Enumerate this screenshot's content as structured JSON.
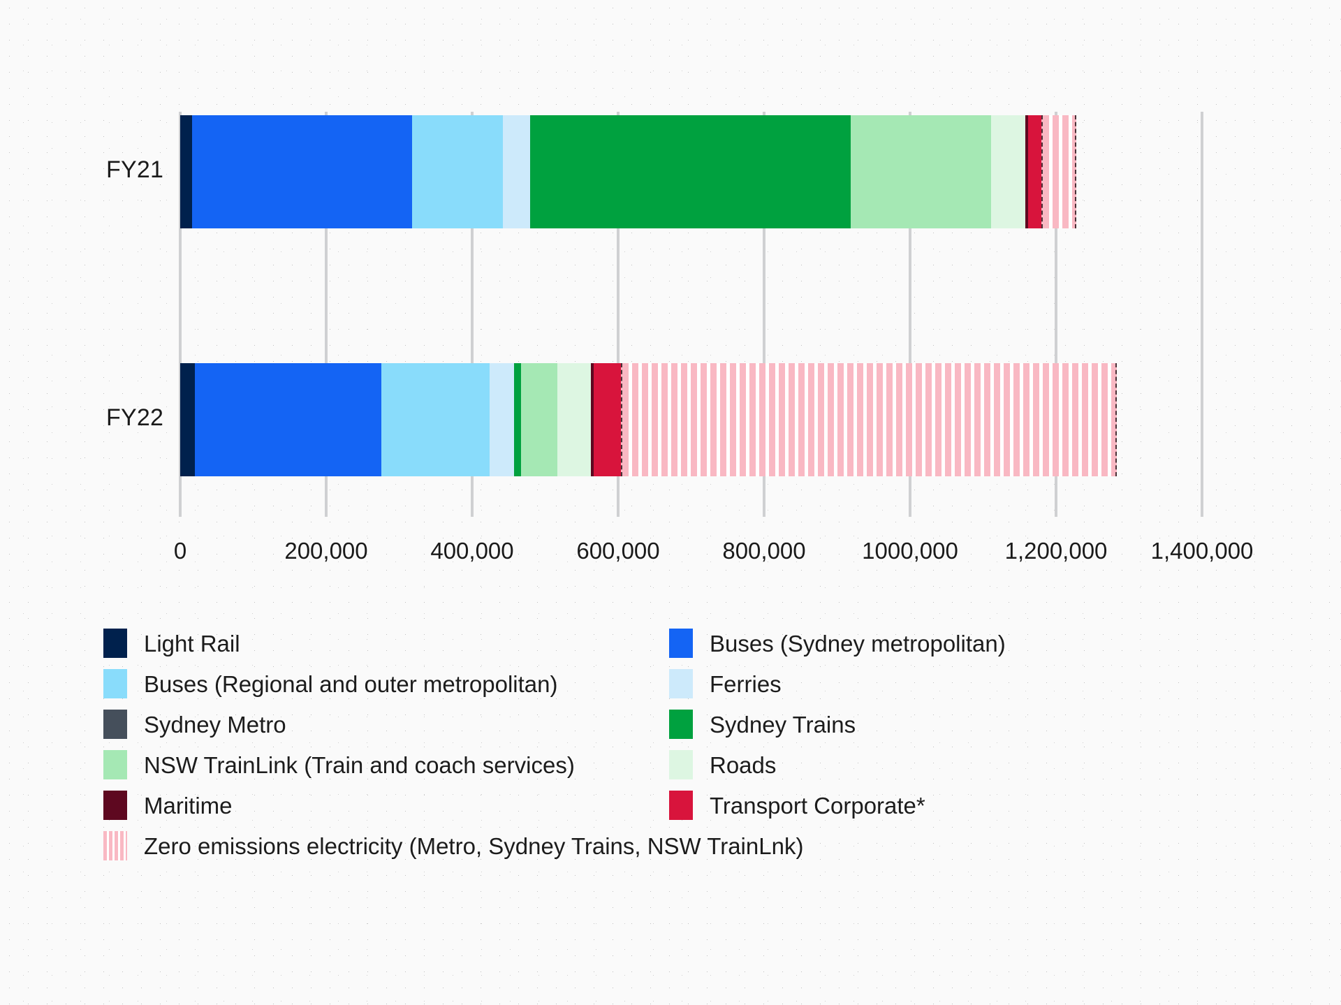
{
  "chart_data": {
    "type": "bar",
    "orientation": "horizontal",
    "stacked": true,
    "title": "",
    "xlabel": "",
    "ylabel": "",
    "categories": [
      "FY21",
      "FY22"
    ],
    "xlim": [
      0,
      1450000
    ],
    "xticks": [
      0,
      200000,
      400000,
      600000,
      800000,
      1000000,
      1200000,
      1400000
    ],
    "xticklabels": [
      "0",
      "200,000",
      "400,000",
      "600,000",
      "800,000",
      "1000,000",
      "1,200,000",
      "1,400,000"
    ],
    "grid": true,
    "grid_axis": "x",
    "legend_position": "bottom",
    "series": [
      {
        "name": "Light Rail",
        "color": "#00214d",
        "values": [
          16000,
          20000
        ]
      },
      {
        "name": "Buses (Sydney metropolitan)",
        "color": "#1464f4",
        "values": [
          302000,
          256000
        ]
      },
      {
        "name": "Buses (Regional and outer metropolitan)",
        "color": "#89dcfb",
        "values": [
          124000,
          148000
        ]
      },
      {
        "name": "Ferries",
        "color": "#cdeafb",
        "values": [
          37000,
          33000
        ]
      },
      {
        "name": "Sydney Metro",
        "color": "#454f5b",
        "values": [
          0,
          0
        ]
      },
      {
        "name": "Sydney Trains",
        "color": "#00a13f",
        "values": [
          440000,
          10000
        ]
      },
      {
        "name": "NSW TrainLink (Train and coach services)",
        "color": "#a5e8b4",
        "values": [
          192000,
          50000
        ]
      },
      {
        "name": "Roads",
        "color": "#ddf6e2",
        "values": [
          47000,
          46000
        ]
      },
      {
        "name": "Maritime",
        "color": "#5e0820",
        "values": [
          4000,
          4000
        ]
      },
      {
        "name": "Transport Corporate*",
        "color": "#d8143c",
        "values": [
          18000,
          37000
        ]
      },
      {
        "name": "Zero emissions electricity (Metro, Sydney Trains, NSW TrainLnk)",
        "color": "#f9b8c3",
        "hatched": true,
        "values": [
          48000,
          679000
        ]
      }
    ],
    "totals": [
      1228000,
      1283000
    ]
  },
  "axis": {
    "categories": [
      "FY21",
      "FY22"
    ],
    "ticklabels": [
      "0",
      "200,000",
      "400,000",
      "600,000",
      "800,000",
      "1000,000",
      "1,200,000",
      "1,400,000"
    ]
  },
  "legend": {
    "rows": [
      [
        {
          "label": "Light Rail",
          "color": "#00214d",
          "hatched": false
        },
        {
          "label": "Buses (Sydney metropolitan)",
          "color": "#1464f4",
          "hatched": false
        }
      ],
      [
        {
          "label": "Buses (Regional and outer metropolitan)",
          "color": "#89dcfb",
          "hatched": false
        },
        {
          "label": "Ferries",
          "color": "#cdeafb",
          "hatched": false
        }
      ],
      [
        {
          "label": "Sydney Metro",
          "color": "#454f5b",
          "hatched": false
        },
        {
          "label": "Sydney Trains",
          "color": "#00a13f",
          "hatched": false
        }
      ],
      [
        {
          "label": "NSW TrainLink (Train and coach services)",
          "color": "#a5e8b4",
          "hatched": false
        },
        {
          "label": "Roads",
          "color": "#ddf6e2",
          "hatched": false
        }
      ],
      [
        {
          "label": "Maritime",
          "color": "#5e0820",
          "hatched": false
        },
        {
          "label": "Transport Corporate*",
          "color": "#d8143c",
          "hatched": false
        }
      ],
      [
        {
          "label": "Zero emissions electricity (Metro, Sydney Trains, NSW TrainLnk)",
          "color": "#f9b8c3",
          "hatched": true
        }
      ]
    ]
  }
}
